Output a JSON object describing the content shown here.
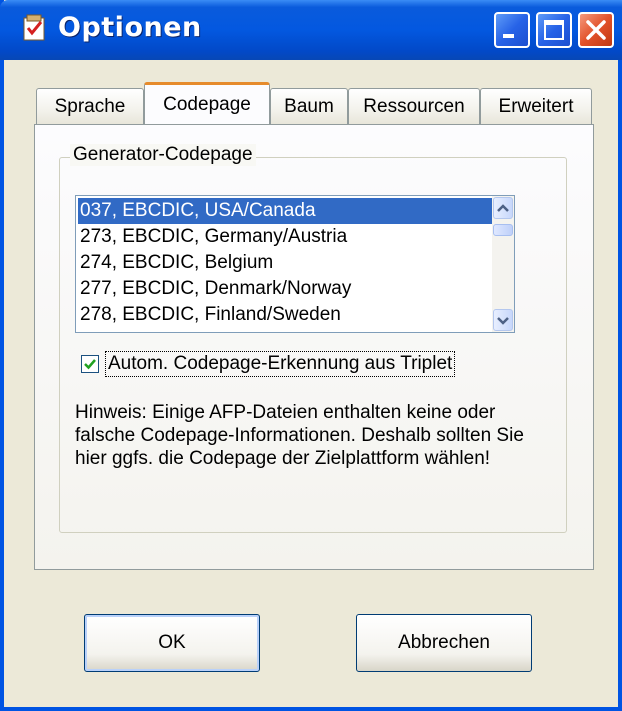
{
  "window": {
    "title": "Optionen",
    "title_icon": "options-checklist-icon",
    "controls": [
      "minimize-icon",
      "maximize-icon",
      "close-icon"
    ]
  },
  "tabs": [
    {
      "label": "Sprache",
      "active": false
    },
    {
      "label": "Codepage",
      "active": true
    },
    {
      "label": "Baum",
      "active": false
    },
    {
      "label": "Ressourcen",
      "active": false
    },
    {
      "label": "Erweitert",
      "active": false
    }
  ],
  "group": {
    "legend": "Generator-Codepage",
    "codepages": [
      "037, EBCDIC, USA/Canada",
      "273, EBCDIC, Germany/Austria",
      "274, EBCDIC, Belgium",
      "277, EBCDIC, Denmark/Norway",
      "278, EBCDIC, Finland/Sweden"
    ],
    "selected_index": 0,
    "auto_detect_label": "Autom. Codepage-Erkennung aus Triplet",
    "auto_detect_checked": true,
    "hint": "Hinweis: Einige AFP-Dateien enthalten keine oder falsche Codepage-Informationen. Deshalb sollten Sie hier ggfs. die Codepage der Zielplattform wählen!"
  },
  "buttons": {
    "ok": "OK",
    "cancel": "Abbrechen"
  },
  "colors": {
    "titlebar": "#0358e0",
    "selection": "#316ac5",
    "dialog_bg": "#ece9d8",
    "close_button": "#e2522a",
    "active_tab_accent": "#e68b2c"
  }
}
